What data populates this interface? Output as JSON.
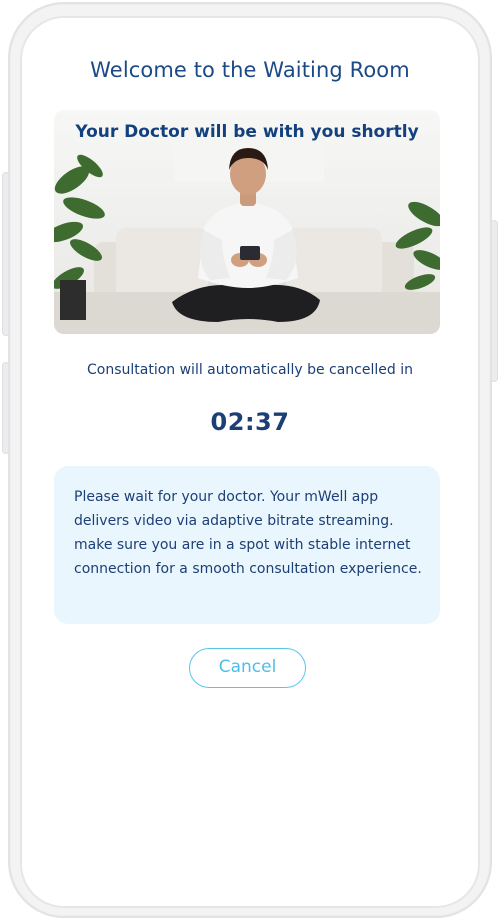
{
  "header": {
    "title": "Welcome to the Waiting Room"
  },
  "hero": {
    "caption": "Your Doctor will be with you shortly"
  },
  "status": {
    "message": "Consultation will automatically be cancelled in",
    "countdown": "02:37"
  },
  "info": {
    "text": "Please wait for your doctor. Your mWell app delivers video via adaptive bitrate streaming. make sure you are in a spot with stable internet connection for a smooth consultation experience."
  },
  "actions": {
    "cancel_label": "Cancel"
  },
  "colors": {
    "title": "#1c4a86",
    "text": "#1c3f75",
    "info_bg": "#eaf6fd",
    "accent": "#5bc4ec"
  }
}
